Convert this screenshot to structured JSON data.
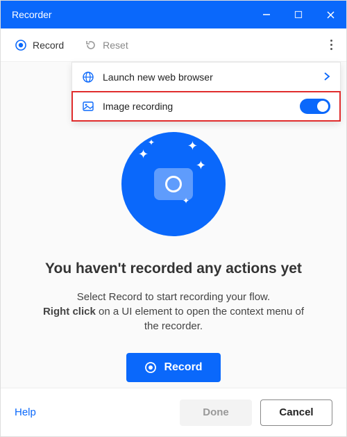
{
  "titlebar": {
    "title": "Recorder"
  },
  "toolbar": {
    "record_label": "Record",
    "reset_label": "Reset"
  },
  "menu": {
    "launch_browser": "Launch new web browser",
    "image_recording": "Image recording",
    "image_recording_on": true
  },
  "empty": {
    "title": "You haven't recorded any actions yet",
    "line1": "Select Record to start recording your flow.",
    "boldPrefix": "Right click",
    "line2_rest": " on a UI element to open the context menu of the recorder.",
    "record_button": "Record"
  },
  "footer": {
    "help": "Help",
    "done": "Done",
    "cancel": "Cancel"
  },
  "colors": {
    "accent": "#0a68fb"
  }
}
